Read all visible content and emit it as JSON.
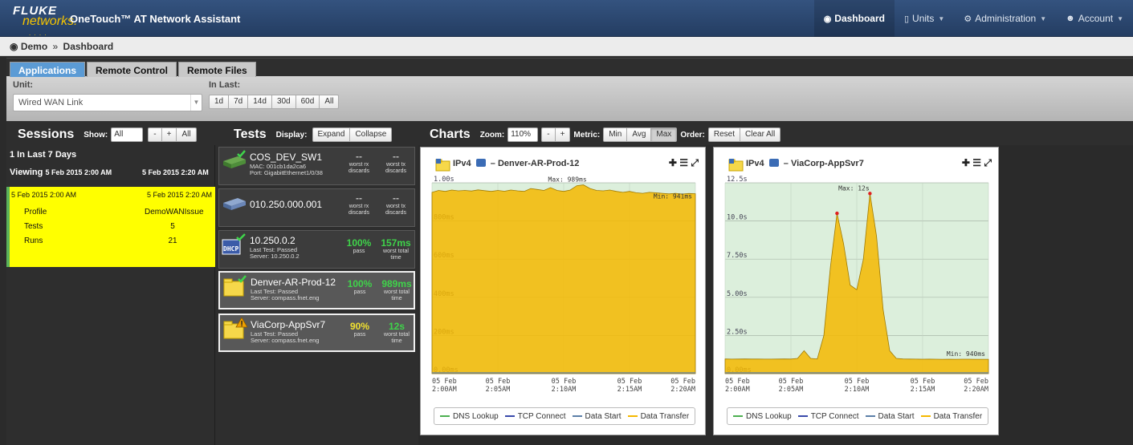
{
  "nav": {
    "brand_top": "FLUKE",
    "brand_bottom": "networks.",
    "brand_dots": ". . . .",
    "app_title": "OneTouch™ AT Network Assistant",
    "items": [
      {
        "label": "Dashboard",
        "icon": "dashboard-icon"
      },
      {
        "label": "Units",
        "icon": "units-icon"
      },
      {
        "label": "Administration",
        "icon": "gears-icon"
      },
      {
        "label": "Account",
        "icon": "users-icon"
      }
    ]
  },
  "breadcrumb": {
    "root": "Demo",
    "sep": "»",
    "current": "Dashboard"
  },
  "tabs": [
    "Applications",
    "Remote Control",
    "Remote Files"
  ],
  "filters": {
    "unit_label": "Unit:",
    "unit_value": "Wired WAN Link",
    "in_last_label": "In Last:",
    "in_last_options": [
      "1d",
      "7d",
      "14d",
      "30d",
      "60d",
      "All"
    ]
  },
  "sessions": {
    "title": "Sessions",
    "show_label": "Show:",
    "show_value": "All",
    "buttons": [
      "-",
      "+",
      "All"
    ],
    "count_text": "1 In Last 7 Days",
    "viewing_label": "Viewing",
    "viewing_start": "5 Feb 2015 2:00 AM",
    "viewing_end": "5 Feb 2015 2:20 AM",
    "card": {
      "start": "5 Feb 2015 2:00 AM",
      "end": "5 Feb 2015 2:20 AM",
      "rows": [
        {
          "label": "Profile",
          "value": "DemoWANIssue"
        },
        {
          "label": "Tests",
          "value": "5"
        },
        {
          "label": "Runs",
          "value": "21"
        }
      ]
    }
  },
  "tests": {
    "title": "Tests",
    "display_label": "Display:",
    "buttons": [
      "Expand",
      "Collapse"
    ],
    "items": [
      {
        "name": "COS_DEV_SW1",
        "sub1": "MAC: 001cb1da2ca6",
        "sub2": "Port: GigabitEthernet1/0/38",
        "v1": "--",
        "l1a": "worst rx",
        "l1b": "discards",
        "v2": "--",
        "l2a": "worst tx",
        "l2b": "discards"
      },
      {
        "name": "010.250.000.001",
        "sub1": "",
        "sub2": "",
        "v1": "--",
        "l1a": "worst rx",
        "l1b": "discards",
        "v2": "--",
        "l2a": "worst tx",
        "l2b": "discards"
      },
      {
        "name": "10.250.0.2",
        "sub1": "Last Test: Passed",
        "sub2": "Server: 10.250.0.2",
        "v1": "100%",
        "l1a": "pass",
        "l1b": "",
        "v2": "157ms",
        "l2a": "worst total",
        "l2b": "time"
      },
      {
        "name": "Denver-AR-Prod-12",
        "sub1": "Last Test: Passed",
        "sub2": "Server: compass.fnet.eng",
        "v1": "100%",
        "l1a": "pass",
        "l1b": "",
        "v2": "989ms",
        "l2a": "worst total",
        "l2b": "time"
      },
      {
        "name": "ViaCorp-AppSvr7",
        "sub1": "Last Test: Passed",
        "sub2": "Server: compass.fnet.eng",
        "v1": "90%",
        "l1a": "pass",
        "l1b": "",
        "v2": "12s",
        "l2a": "worst total",
        "l2b": "time"
      }
    ]
  },
  "charts_bar": {
    "title": "Charts",
    "zoom_label": "Zoom:",
    "zoom_value": "110%",
    "zoom_buttons": [
      "-",
      "+"
    ],
    "metric_label": "Metric:",
    "metric_buttons": [
      "Min",
      "Avg",
      "Max"
    ],
    "order_label": "Order:",
    "order_buttons": [
      "Reset",
      "Clear All"
    ]
  },
  "chart_data": [
    {
      "type": "area",
      "title_prefix": "IPv4",
      "title": "Denver-AR-Prod-12",
      "x": [
        "05 Feb 2:00AM",
        "05 Feb 2:05AM",
        "05 Feb 2:10AM",
        "05 Feb 2:15AM",
        "05 Feb 2:20AM"
      ],
      "yticks": [
        "0.00ms",
        "200ms",
        "400ms",
        "600ms",
        "800ms",
        "1.00s"
      ],
      "ylim_ms": [
        0,
        1000
      ],
      "max_label": "Max: 989ms",
      "min_label": "Min: 941ms",
      "series": [
        {
          "name": "DNS Lookup",
          "color": "#4caf50"
        },
        {
          "name": "TCP Connect",
          "color": "#3949ab"
        },
        {
          "name": "Data Start",
          "color": "#5b7fa8"
        },
        {
          "name": "Data Transfer",
          "color": "#f5b800",
          "values_ms": [
            950,
            960,
            955,
            962,
            958,
            960,
            957,
            963,
            959,
            955,
            960,
            956,
            962,
            958,
            955,
            970,
            965,
            960,
            975,
            960,
            955,
            962,
            985,
            989,
            970,
            960,
            958,
            962,
            955,
            950,
            955,
            948,
            945,
            950,
            948,
            945,
            942,
            945,
            941,
            944,
            943
          ]
        }
      ]
    },
    {
      "type": "area",
      "title_prefix": "IPv4",
      "title": "ViaCorp-AppSvr7",
      "x": [
        "05 Feb 2:00AM",
        "05 Feb 2:05AM",
        "05 Feb 2:10AM",
        "05 Feb 2:15AM",
        "05 Feb 2:20AM"
      ],
      "yticks": [
        "0.00ms",
        "2.50s",
        "5.00s",
        "7.50s",
        "10.0s",
        "12.5s"
      ],
      "ylim_ms": [
        0,
        12500
      ],
      "max_label": "Max: 12s",
      "min_label": "Min: 940ms",
      "series": [
        {
          "name": "DNS Lookup",
          "color": "#4caf50"
        },
        {
          "name": "TCP Connect",
          "color": "#3949ab"
        },
        {
          "name": "Data Start",
          "color": "#5b7fa8"
        },
        {
          "name": "Data Transfer",
          "color": "#f5b800",
          "values_ms": [
            960,
            950,
            955,
            960,
            958,
            955,
            950,
            952,
            958,
            960,
            955,
            1000,
            1500,
            1000,
            960,
            2500,
            7000,
            10500,
            8500,
            5800,
            5500,
            7500,
            11800,
            9000,
            4200,
            1500,
            1000,
            960,
            955,
            950,
            945,
            950,
            948,
            942,
            945,
            940,
            943,
            945,
            942,
            941,
            940
          ]
        }
      ]
    }
  ]
}
